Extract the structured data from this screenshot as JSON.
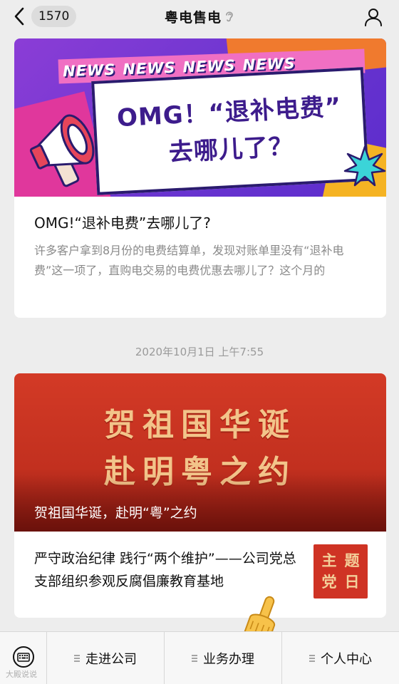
{
  "header": {
    "back_count": "1570",
    "title": "粤电售电"
  },
  "article_1": {
    "banner": {
      "news_words": [
        "NEWS",
        "NEWS",
        "NEWS",
        "NEWS"
      ],
      "headline_line_1": "OMG！“退补电费”",
      "headline_line_2": "去哪儿了？"
    },
    "title": "OMG!“退补电费”去哪儿了?",
    "description": "许多客户拿到8月份的电费结算单，发现对账单里没有“退补电费”这一项了，直购电交易的电费优惠去哪儿了？这个月的"
  },
  "timestamp": "2020年10月1日 上午7:55",
  "article_2": {
    "banner": {
      "art_line_1": "贺祖国华诞",
      "art_line_2": "赴明粤之约",
      "caption": "贺祖国华诞，赴明“粤”之约"
    },
    "sub_item": {
      "title": "严守政治纪律 践行“两个维护”——公司党总支部组织参观反腐倡廉教育基地",
      "thumb_chars": [
        "主",
        "题",
        "党",
        "日"
      ]
    }
  },
  "bottom_menu": {
    "items": [
      {
        "label": "走进公司"
      },
      {
        "label": "业务办理"
      },
      {
        "label": "个人中心"
      }
    ]
  },
  "watermark": "大殿说说",
  "colors": {
    "background": "#ededed",
    "card": "#ffffff",
    "banner_purple": "#6a35d0",
    "banner_red": "#c2301f",
    "muted_text": "#8a8a8a"
  },
  "icons": {
    "back": "chevron-left-icon",
    "ear": "ear-icon",
    "profile": "person-icon",
    "keyboard": "keyboard-icon",
    "menu": "menu-lines-icon",
    "hand": "pointing-hand-icon"
  }
}
